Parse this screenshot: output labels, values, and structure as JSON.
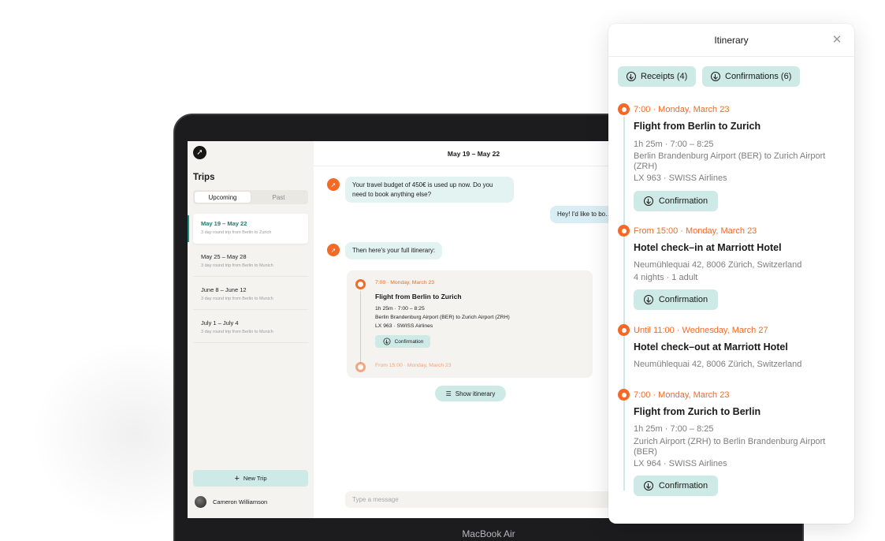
{
  "laptop": {
    "brand": "MacBook Air"
  },
  "sidebar": {
    "title": "Trips",
    "tabs": [
      "Upcoming",
      "Past"
    ],
    "active_tab": "Upcoming",
    "trips": [
      {
        "dates": "May 19 – May 22",
        "subtitle": "3 day round trip from Berlin to Zurich",
        "active": true
      },
      {
        "dates": "May 25 – May 28",
        "subtitle": "3 day round trip from Berlin to Munich"
      },
      {
        "dates": "June 8 – June 12",
        "subtitle": "3 day round trip from Berlin to Munich"
      },
      {
        "dates": "July 1 – July 4",
        "subtitle": "3 day round trip from Berlin to Munich"
      }
    ],
    "new_trip": "New Trip",
    "user": "Cameron Williamson"
  },
  "chat": {
    "header": "May 19 – May 22",
    "messages": [
      {
        "from": "bot",
        "text": "Your travel budget of 450€ is used up now. Do you need to book anything else?"
      },
      {
        "from": "user",
        "text": "Hey! I'd like to bo… to this Friday. Bud…"
      },
      {
        "from": "bot",
        "text": "Then here's your full itinerary:"
      }
    ],
    "card": {
      "time": "7:00 · Monday, March 23",
      "title": "Flight from Berlin to Zurich",
      "line1": "1h 25m · 7:00 – 8:25",
      "line2": "Berlin Brandenburg Airport (BER) to Zurich Airport (ZRH)",
      "line3": "LX 963 · SWISS Airlines",
      "confirm": "Confirmation",
      "next_time": "From 15:00 · Monday, March 23"
    },
    "show_itinerary": "Show itinerary",
    "input_placeholder": "Type a message"
  },
  "itinerary": {
    "title": "Itinerary",
    "receipts": "Receipts (4)",
    "confirmations": "Confirmations (6)",
    "events": [
      {
        "time": "7:00 · Monday, March 23",
        "title": "Flight from Berlin to Zurich",
        "l1": "1h 25m · 7:00 – 8:25",
        "l2": "Berlin Brandenburg Airport (BER) to Zurich Airport (ZRH)",
        "l3": "LX 963 · SWISS Airlines",
        "button": "Confirmation"
      },
      {
        "time": "From 15:00 · Monday, March 23",
        "title": "Hotel check–in at Marriott Hotel",
        "l1": "Neumühlequai 42, 8006 Zürich, Switzerland",
        "l2": "4 nights · 1 adult",
        "button": "Confirmation"
      },
      {
        "time": "Until 11:00 · Wednesday, March 27",
        "title": "Hotel check–out at Marriott Hotel",
        "l1": "Neumühlequai 42, 8006 Zürich, Switzerland"
      },
      {
        "time": "7:00 · Monday, March 23",
        "title": "Flight from Zurich to Berlin",
        "l1": "1h 25m · 7:00 – 8:25",
        "l2": "Zurich Airport (ZRH) to Berlin Brandenburg Airport (BER)",
        "l3": "LX 964 · SWISS Airlines",
        "button": "Confirmation"
      }
    ]
  },
  "colors": {
    "accent": "#f26a25",
    "mint": "#cdeae6",
    "sidebar_bg": "#f4f3ef"
  }
}
